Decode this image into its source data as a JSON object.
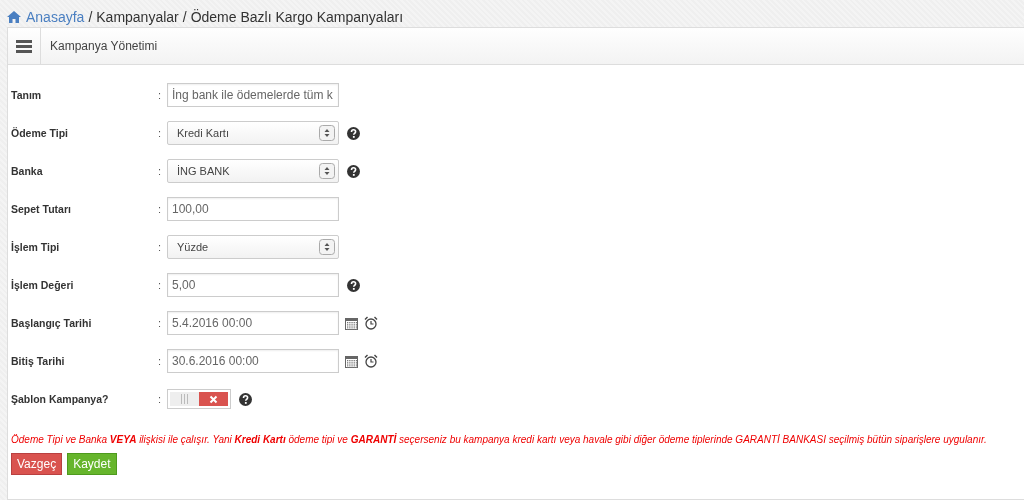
{
  "breadcrumb": [
    {
      "label": "Anasayfa",
      "kind": "link"
    },
    {
      "label": "Kampanyalar",
      "kind": "text"
    },
    {
      "label": "Ödeme Bazlı Kargo Kampanyaları",
      "kind": "text"
    }
  ],
  "breadcrumb_separator": "/",
  "panel": {
    "title": "Kampanya Yönetimi"
  },
  "fields": [
    {
      "label": "Tanım",
      "kind": "input",
      "value": "İng bank ile ödemelerde tüm k",
      "help": false
    },
    {
      "label": "Ödeme Tipi",
      "kind": "select",
      "value": "Kredi Kartı",
      "help": true
    },
    {
      "label": "Banka",
      "kind": "select",
      "value": "İNG BANK",
      "help": true
    },
    {
      "label": "Sepet Tutarı",
      "kind": "input",
      "value": "100,00",
      "help": false
    },
    {
      "label": "İşlem Tipi",
      "kind": "select",
      "value": "Yüzde",
      "help": false
    },
    {
      "label": "İşlem Değeri",
      "kind": "input",
      "value": "5,00",
      "help": true
    },
    {
      "label": "Başlangıç Tarihi",
      "kind": "date",
      "value": "5.4.2016 00:00",
      "help": false
    },
    {
      "label": "Bitiş Tarihi",
      "kind": "date",
      "value": "30.6.2016 00:00",
      "help": false
    },
    {
      "label": "Şablon Kampanya?",
      "kind": "toggle",
      "on": false,
      "help": true
    }
  ],
  "colon": ":",
  "note": "Ödeme Tipi ve Banka **VEYA** ilişkisi ile çalışır. Yani **Kredi Kartı** ödeme tipi ve **GARANTİ** seçerseniz bu kampanya kredi kartı veya havale gibi diğer ödeme tiplerinde GARANTİ BANKASI seçilmiş bütün siparişlere uygulanır.",
  "buttons": [
    {
      "label": "Vazgeç",
      "kind": "cancel"
    },
    {
      "label": "Kaydet",
      "kind": "save"
    }
  ]
}
